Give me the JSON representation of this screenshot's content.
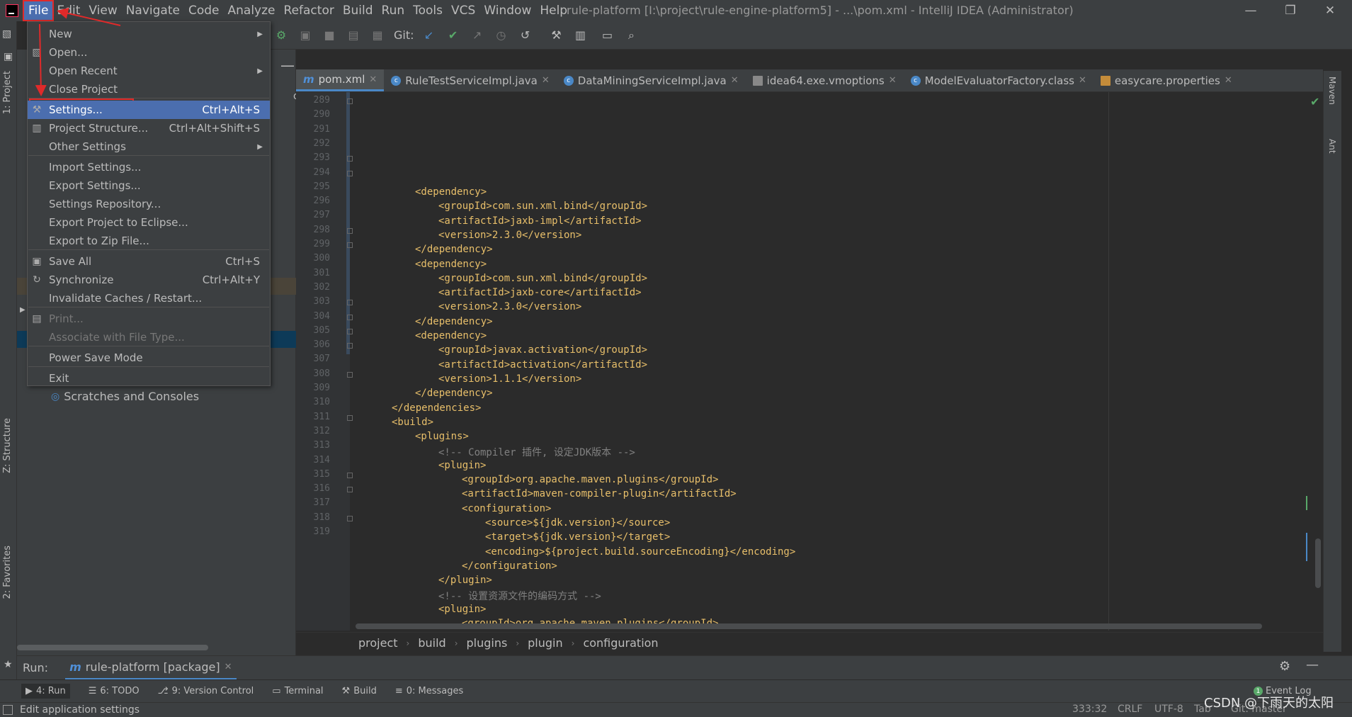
{
  "menubar": {
    "items": [
      "File",
      "Edit",
      "View",
      "Navigate",
      "Code",
      "Analyze",
      "Refactor",
      "Build",
      "Run",
      "Tools",
      "VCS",
      "Window",
      "Help"
    ],
    "window_title": "rule-platform [I:\\project\\rule-engine-platform5] - ...\\pom.xml - IntelliJ IDEA (Administrator)"
  },
  "toolbar": {
    "git_label": "Git:"
  },
  "left_strip": {
    "project": "1: Project",
    "structure": "Z: Structure",
    "favorites": "2: Favorites"
  },
  "right_strip": {
    "maven": "Maven",
    "ant": "Ant"
  },
  "file_menu": {
    "items": [
      {
        "label": "New",
        "shortcut": "",
        "submenu": true
      },
      {
        "label": "Open...",
        "shortcut": ""
      },
      {
        "label": "Open Recent",
        "shortcut": "",
        "submenu": true
      },
      {
        "label": "Close Project",
        "shortcut": ""
      },
      {
        "label": "Settings...",
        "shortcut": "Ctrl+Alt+S"
      },
      {
        "label": "Project Structure...",
        "shortcut": "Ctrl+Alt+Shift+S"
      },
      {
        "label": "Other Settings",
        "shortcut": "",
        "submenu": true
      },
      {
        "label": "Import Settings...",
        "shortcut": ""
      },
      {
        "label": "Export Settings...",
        "shortcut": ""
      },
      {
        "label": "Settings Repository...",
        "shortcut": ""
      },
      {
        "label": "Export Project to Eclipse...",
        "shortcut": ""
      },
      {
        "label": "Export to Zip File...",
        "shortcut": ""
      },
      {
        "label": "Save All",
        "shortcut": "Ctrl+S"
      },
      {
        "label": "Synchronize",
        "shortcut": "Ctrl+Alt+Y"
      },
      {
        "label": "Invalidate Caches / Restart...",
        "shortcut": ""
      },
      {
        "label": "Print...",
        "shortcut": ""
      },
      {
        "label": "Associate with File Type...",
        "shortcut": ""
      },
      {
        "label": "Power Save Mode",
        "shortcut": ""
      },
      {
        "label": "Exit",
        "shortcut": ""
      }
    ]
  },
  "project_panel": {
    "header_fragment": "ojec",
    "scratches": "Scratches and Consoles"
  },
  "editor_tabs": [
    {
      "label": "pom.xml",
      "active": true
    },
    {
      "label": "RuleTestServiceImpl.java"
    },
    {
      "label": "DataMiningServiceImpl.java"
    },
    {
      "label": "idea64.exe.vmoptions"
    },
    {
      "label": "ModelEvaluatorFactory.class"
    },
    {
      "label": "easycare.properties"
    }
  ],
  "editor": {
    "lines": [
      {
        "n": "289",
        "indent": 2,
        "text": "<dependency>"
      },
      {
        "n": "290",
        "indent": 3,
        "text": "<groupId>com.sun.xml.bind</groupId>"
      },
      {
        "n": "291",
        "indent": 3,
        "text": "<artifactId>jaxb-impl</artifactId>"
      },
      {
        "n": "292",
        "indent": 3,
        "text": "<version>2.3.0</version>"
      },
      {
        "n": "293",
        "indent": 2,
        "text": "</dependency>"
      },
      {
        "n": "294",
        "indent": 2,
        "text": "<dependency>"
      },
      {
        "n": "295",
        "indent": 3,
        "text": "<groupId>com.sun.xml.bind</groupId>"
      },
      {
        "n": "296",
        "indent": 3,
        "text": "<artifactId>jaxb-core</artifactId>"
      },
      {
        "n": "297",
        "indent": 3,
        "text": "<version>2.3.0</version>"
      },
      {
        "n": "298",
        "indent": 2,
        "text": "</dependency>"
      },
      {
        "n": "299",
        "indent": 2,
        "text": "<dependency>"
      },
      {
        "n": "300",
        "indent": 3,
        "text": "<groupId>javax.activation</groupId>"
      },
      {
        "n": "301",
        "indent": 3,
        "text": "<artifactId>activation</artifactId>"
      },
      {
        "n": "302",
        "indent": 3,
        "text": "<version>1.1.1</version>"
      },
      {
        "n": "303",
        "indent": 2,
        "text": "</dependency>"
      },
      {
        "n": "304",
        "indent": 1,
        "text": "</dependencies>"
      },
      {
        "n": "305",
        "indent": 1,
        "text": "<build>"
      },
      {
        "n": "306",
        "indent": 2,
        "text": "<plugins>"
      },
      {
        "n": "307",
        "indent": 3,
        "text": "<!-- Compiler 插件, 设定JDK版本 -->",
        "comment": true
      },
      {
        "n": "308",
        "indent": 3,
        "text": "<plugin>"
      },
      {
        "n": "309",
        "indent": 4,
        "text": "<groupId>org.apache.maven.plugins</groupId>"
      },
      {
        "n": "310",
        "indent": 4,
        "text": "<artifactId>maven-compiler-plugin</artifactId>"
      },
      {
        "n": "311",
        "indent": 4,
        "text": "<configuration>"
      },
      {
        "n": "312",
        "indent": 5,
        "text": "<source>${jdk.version}</source>"
      },
      {
        "n": "313",
        "indent": 5,
        "text": "<target>${jdk.version}</target>"
      },
      {
        "n": "314",
        "indent": 5,
        "text": "<encoding>${project.build.sourceEncoding}</encoding>"
      },
      {
        "n": "315",
        "indent": 4,
        "text": "</configuration>"
      },
      {
        "n": "316",
        "indent": 3,
        "text": "</plugin>"
      },
      {
        "n": "317",
        "indent": 3,
        "text": "<!-- 设置资源文件的编码方式 -->",
        "comment": true
      },
      {
        "n": "318",
        "indent": 3,
        "text": "<plugin>"
      },
      {
        "n": "319",
        "indent": 4,
        "text": "<groupId>org.apache.maven.plugins</groupId>"
      }
    ]
  },
  "breadcrumb": [
    "project",
    "build",
    "plugins",
    "plugin",
    "configuration"
  ],
  "run_bar": {
    "label": "Run:",
    "tab": "rule-platform [package]"
  },
  "tool_windows": [
    {
      "label": "4: Run",
      "active": true
    },
    {
      "label": "6: TODO"
    },
    {
      "label": "9: Version Control"
    },
    {
      "label": "Terminal"
    },
    {
      "label": "Build"
    },
    {
      "label": "0: Messages"
    }
  ],
  "event_log": "Event Log",
  "status": {
    "text": "Edit application settings",
    "position": "333:32",
    "line_sep": "CRLF",
    "encoding": "UTF-8",
    "indent": "Tab",
    "vcs": "Git: master"
  },
  "watermark": "CSDN @下雨天的太阳",
  "colors": {
    "accent": "#4b6eaf",
    "annotation": "#e02a2a",
    "tag": "#e8bf6a"
  }
}
